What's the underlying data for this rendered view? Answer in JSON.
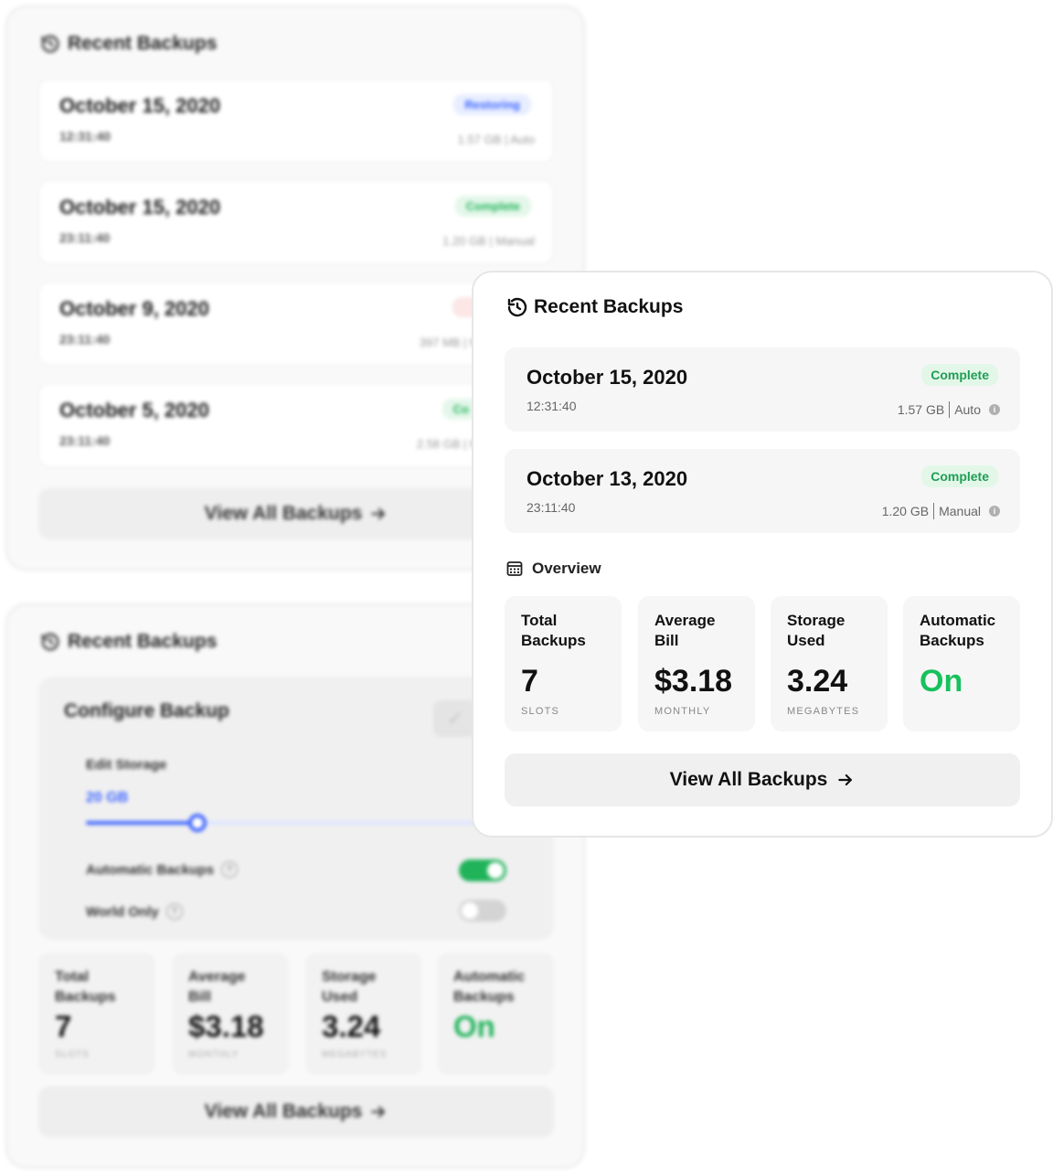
{
  "background_card_1": {
    "title": "Recent Backups",
    "items": [
      {
        "date": "October 15, 2020",
        "time": "12:31:40",
        "status": "Restoring",
        "meta": "1.57 GB | Auto"
      },
      {
        "date": "October 15, 2020",
        "time": "23:11:40",
        "status": "Complete",
        "meta": "1.20 GB | Manual"
      },
      {
        "date": "October 9, 2020",
        "time": "23:11:40",
        "status": "",
        "meta": "397 MB | M"
      },
      {
        "date": "October 5, 2020",
        "time": "23:11:40",
        "status": "Co",
        "meta": "2.58 GB | M"
      }
    ],
    "view_all_label": "View All Backups"
  },
  "background_card_2": {
    "title": "Recent Backups",
    "configure": {
      "title": "Configure Backup",
      "edit_storage_label": "Edit Storage",
      "storage_value": "20 GB",
      "slider_fraction": 0.26,
      "automatic_backups_label": "Automatic Backups",
      "automatic_backups_on": true,
      "world_only_label": "World Only",
      "world_only_on": false
    },
    "stats": [
      {
        "label_line1": "Total",
        "label_line2": "Backups",
        "value": "7",
        "unit": "SLOTS"
      },
      {
        "label_line1": "Average",
        "label_line2": "Bill",
        "value": "$3.18",
        "unit": "MONTHLY"
      },
      {
        "label_line1": "Storage",
        "label_line2": "Used",
        "value": "3.24",
        "unit": "MEGABYTES"
      },
      {
        "label_line1": "Automatic",
        "label_line2": "Backups",
        "value": "On",
        "unit": ""
      }
    ],
    "view_all_label": "View All Backups"
  },
  "card": {
    "title": "Recent Backups",
    "backups": [
      {
        "date": "October 15, 2020",
        "time": "12:31:40",
        "status": "Complete",
        "size": "1.57 GB",
        "type": "Auto"
      },
      {
        "date": "October 13, 2020",
        "time": "23:11:40",
        "status": "Complete",
        "size": "1.20 GB",
        "type": "Manual"
      }
    ],
    "overview_title": "Overview",
    "stats": [
      {
        "label_line1": "Total",
        "label_line2": "Backups",
        "value": "7",
        "unit": "SLOTS"
      },
      {
        "label_line1": "Average",
        "label_line2": "Bill",
        "value": "$3.18",
        "unit": "MONTHLY"
      },
      {
        "label_line1": "Storage",
        "label_line2": "Used",
        "value": "3.24",
        "unit": "MEGABYTES"
      },
      {
        "label_line1": "Automatic",
        "label_line2": "Backups",
        "value": "On",
        "unit": ""
      }
    ],
    "view_all_label": "View All Backups"
  },
  "icons": {
    "history": "history-icon",
    "calendar": "calendar-icon",
    "info": "info-icon",
    "arrow": "arrow-right-icon",
    "help": "question-icon",
    "check": "check-icon"
  },
  "colors": {
    "complete_text": "#1f9e55",
    "complete_bg": "#e3f7e9",
    "restoring_text": "#3b63ff",
    "on_green": "#17c15c",
    "accent_blue": "#3b63ff"
  }
}
